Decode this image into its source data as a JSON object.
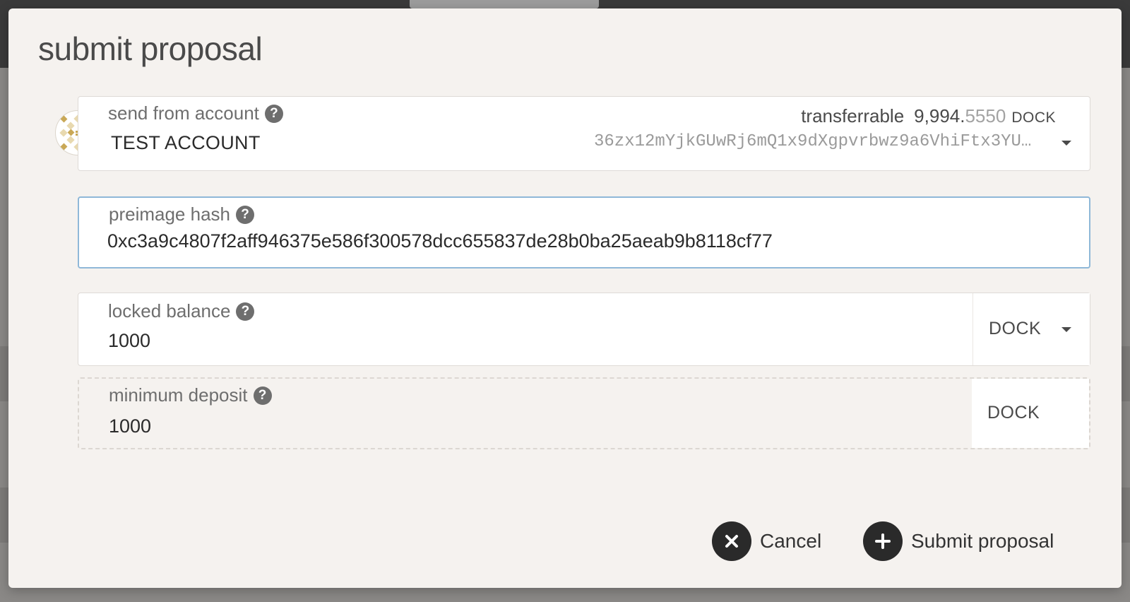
{
  "modal": {
    "title": "submit proposal"
  },
  "account": {
    "label": "send from account",
    "name": "TEST ACCOUNT",
    "transferrable_label": "transferrable",
    "transferrable_integer": "9,994.",
    "transferrable_decimal": "5550",
    "transferrable_unit": "DOCK",
    "address": "36zx12mYjkGUwRj6mQ1x9dXgpvrbwz9a6VhiFtx3YU…"
  },
  "preimage": {
    "label": "preimage hash",
    "value": "0xc3a9c4807f2aff946375e586f300578dcc655837de28b0ba25aeab9b8118cf77"
  },
  "locked_balance": {
    "label": "locked balance",
    "value": "1000",
    "unit": "DOCK"
  },
  "minimum_deposit": {
    "label": "minimum deposit",
    "value": "1000",
    "unit": "DOCK"
  },
  "actions": {
    "cancel_label": "Cancel",
    "submit_label": "Submit proposal"
  },
  "icons": {
    "help": "question-circle-icon",
    "cancel": "close-icon",
    "submit": "plus-icon",
    "dropdown": "caret-down-icon",
    "avatar": "identicon"
  },
  "colors": {
    "modal_bg": "#f5f2ef",
    "focus_border": "#8fb8d8",
    "button_circle": "#2a2a2a",
    "identicon": "#c9a856"
  }
}
